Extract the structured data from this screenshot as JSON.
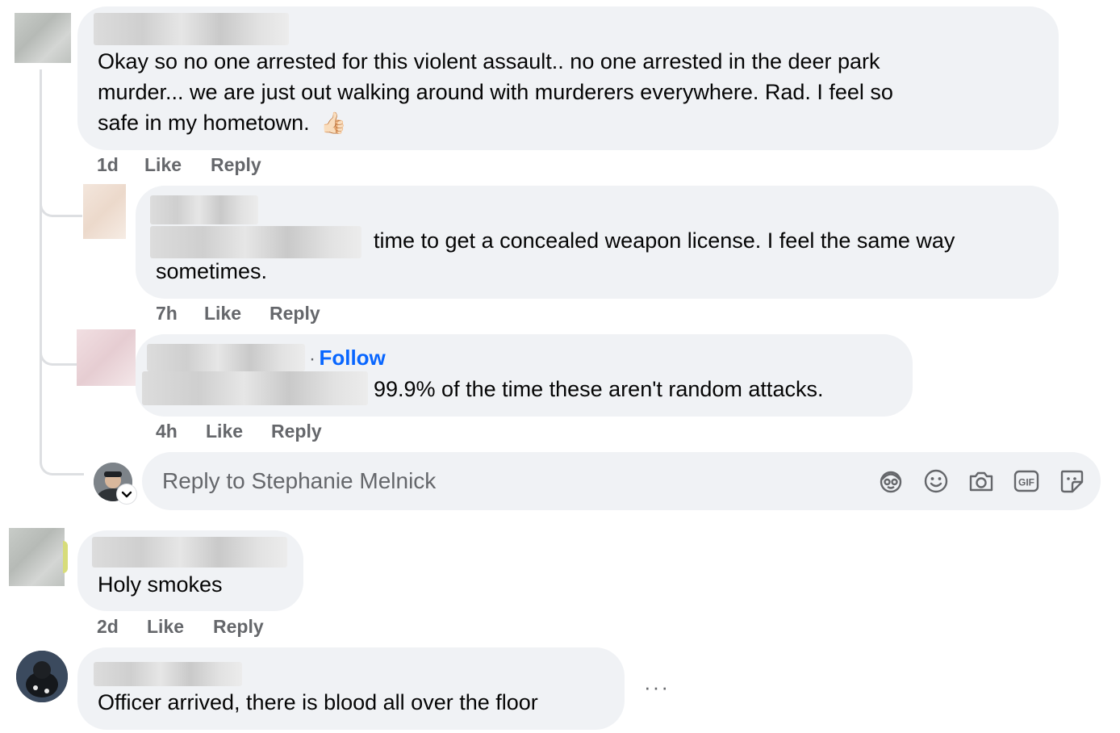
{
  "comments": [
    {
      "text_lines": [
        "Okay so no one arrested for this violent assault.. no one arrested in the deer park",
        "murder... we are just out walking around with murderers everywhere. Rad. I feel so",
        "safe in my hometown."
      ],
      "emoji": "👍🏻",
      "time": "1d",
      "like": "Like",
      "reply": "Reply"
    },
    {
      "text_lines": [
        "time to get a concealed weapon license. I feel the same way",
        "sometimes."
      ],
      "time": "7h",
      "like": "Like",
      "reply": "Reply"
    },
    {
      "follow_sep": "·",
      "follow": "Follow",
      "text": "99.9% of the time these aren't random attacks.",
      "time": "4h",
      "like": "Like",
      "reply": "Reply"
    },
    {
      "text": "Holy smokes",
      "time": "2d",
      "like": "Like",
      "reply": "Reply"
    },
    {
      "text": "Officer arrived, there is blood all over the floor",
      "more": "···"
    }
  ],
  "reply_box": {
    "placeholder": "Reply to Stephanie Melnick",
    "icons": [
      "avatar-sticker-icon",
      "emoji-icon",
      "camera-icon",
      "gif-icon",
      "sticker-icon"
    ],
    "gif_label": "GIF"
  },
  "colors": {
    "bubble": "#f0f2f5",
    "muted": "#65676b",
    "link": "#0866ff"
  }
}
